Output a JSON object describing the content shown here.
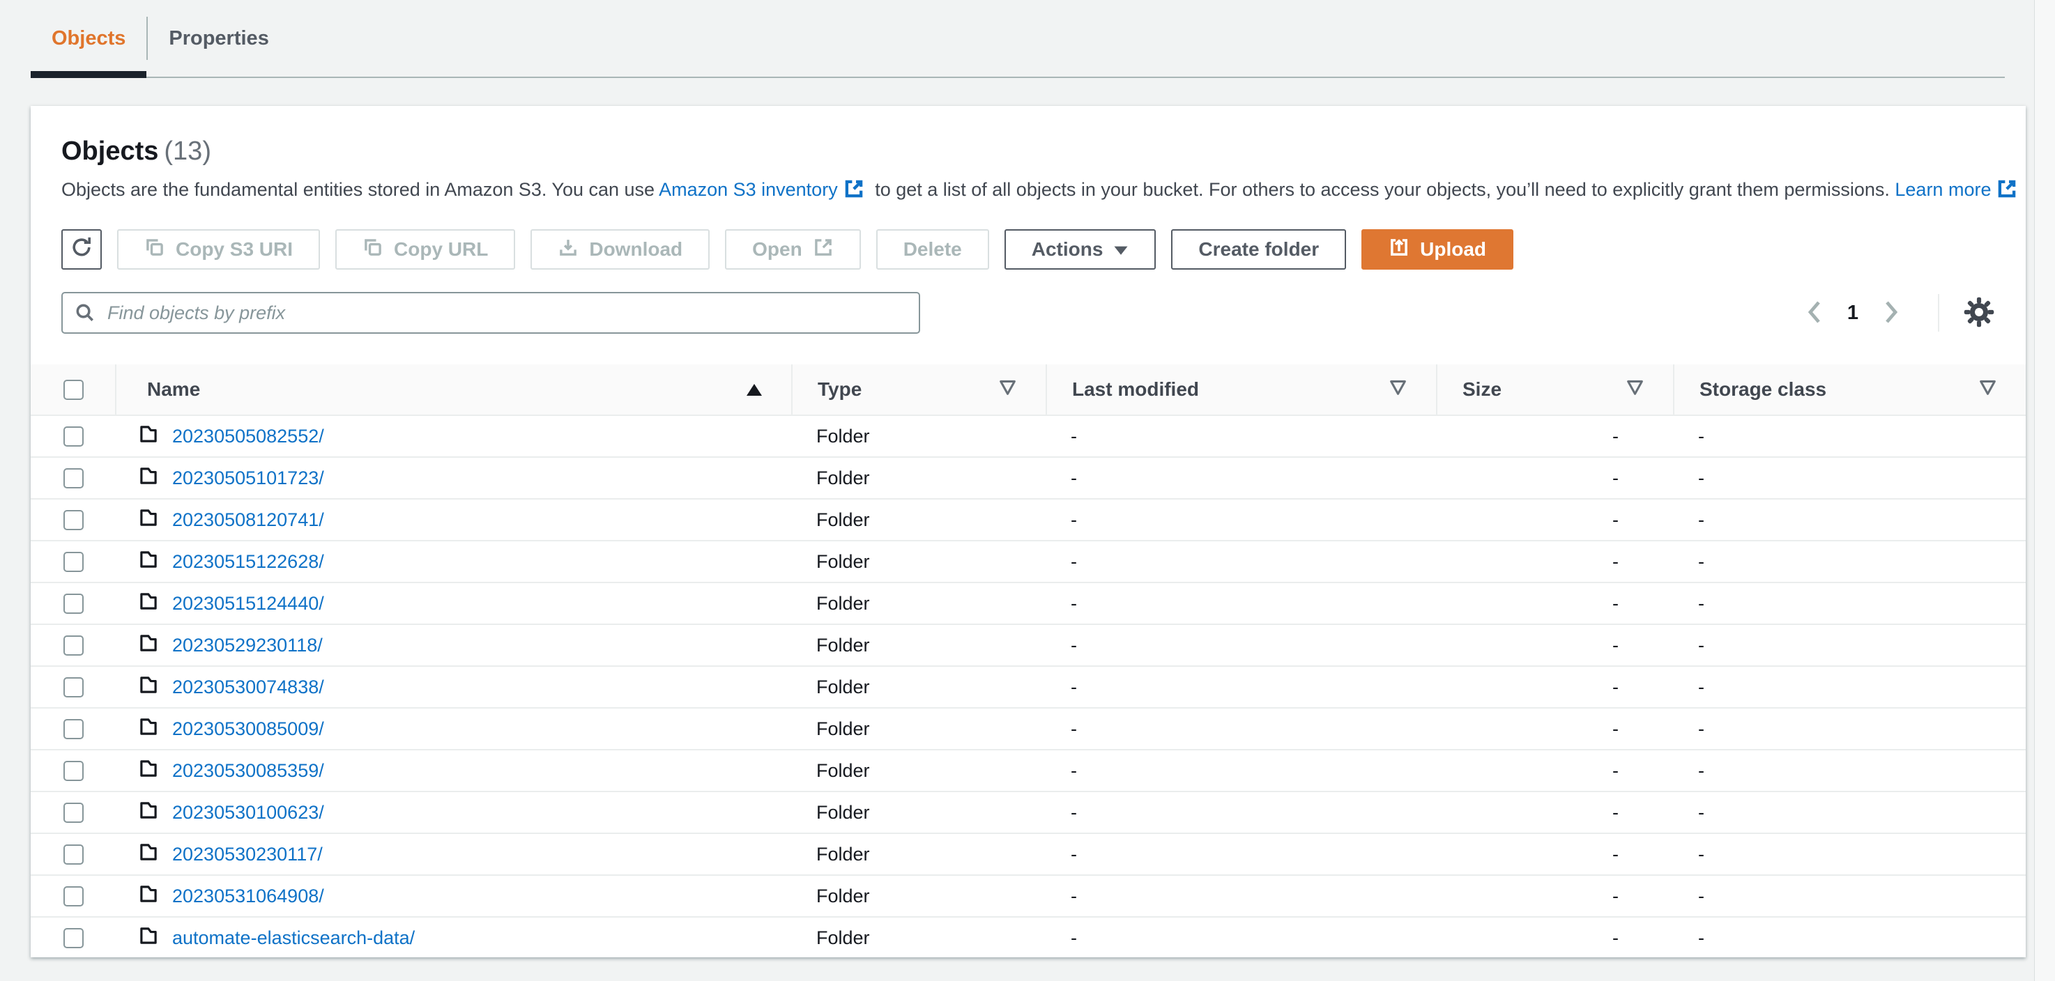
{
  "colors": {
    "accent_orange": "#df7732",
    "tab_active_orange": "#e0752c",
    "link_blue": "#0f72c7",
    "page_background": "#f1f3f3",
    "card_background": "#ffffff",
    "secondary_button": "#545b64",
    "disabled_text": "#aab7b8",
    "row_border": "#eaeded"
  },
  "tabs": [
    {
      "label": "Objects",
      "active": true
    },
    {
      "label": "Properties",
      "active": false
    }
  ],
  "panel": {
    "title": "Objects",
    "count": "(13)",
    "description": {
      "text_1": "Objects are the fundamental entities stored in Amazon S3. You can use ",
      "link_1": "Amazon S3 inventory",
      "text_2": " to get a list of all objects in your bucket. For others to access your objects, you’ll need to explicitly grant them permissions. ",
      "link_2": "Learn more"
    },
    "toolbar": {
      "buttons": [
        {
          "label": "",
          "icon": "refresh-icon",
          "disabled": false
        },
        {
          "label": "Copy S3 URI",
          "icon": "copy-icon",
          "disabled": true
        },
        {
          "label": "Copy URL",
          "icon": "copy-icon",
          "disabled": true
        },
        {
          "label": "Download",
          "icon": "download-icon",
          "disabled": true
        },
        {
          "label": "Open",
          "icon": "external-link-icon",
          "disabled": true
        },
        {
          "label": "Delete",
          "icon": null,
          "disabled": true
        },
        {
          "label": "Actions",
          "icon": "caret-down-icon",
          "disabled": false
        },
        {
          "label": "Create folder",
          "icon": null,
          "disabled": false
        },
        {
          "label": "Upload",
          "icon": "upload-icon",
          "disabled": false,
          "variant": "primary"
        }
      ]
    },
    "search": {
      "placeholder": "Find objects by prefix"
    },
    "pagination": {
      "current_page": "1"
    },
    "table": {
      "columns": [
        {
          "label": "Name",
          "sorted": "ascending"
        },
        {
          "label": "Type",
          "filter": true
        },
        {
          "label": "Last modified",
          "filter": true
        },
        {
          "label": "Size",
          "filter": true
        },
        {
          "label": "Storage class",
          "filter": true
        }
      ],
      "rows": [
        {
          "name": "20230505082552/",
          "type": "Folder",
          "last_modified": "-",
          "size": "-",
          "storage_class": "-"
        },
        {
          "name": "20230505101723/",
          "type": "Folder",
          "last_modified": "-",
          "size": "-",
          "storage_class": "-"
        },
        {
          "name": "20230508120741/",
          "type": "Folder",
          "last_modified": "-",
          "size": "-",
          "storage_class": "-"
        },
        {
          "name": "20230515122628/",
          "type": "Folder",
          "last_modified": "-",
          "size": "-",
          "storage_class": "-"
        },
        {
          "name": "20230515124440/",
          "type": "Folder",
          "last_modified": "-",
          "size": "-",
          "storage_class": "-"
        },
        {
          "name": "20230529230118/",
          "type": "Folder",
          "last_modified": "-",
          "size": "-",
          "storage_class": "-"
        },
        {
          "name": "20230530074838/",
          "type": "Folder",
          "last_modified": "-",
          "size": "-",
          "storage_class": "-"
        },
        {
          "name": "20230530085009/",
          "type": "Folder",
          "last_modified": "-",
          "size": "-",
          "storage_class": "-"
        },
        {
          "name": "20230530085359/",
          "type": "Folder",
          "last_modified": "-",
          "size": "-",
          "storage_class": "-"
        },
        {
          "name": "20230530100623/",
          "type": "Folder",
          "last_modified": "-",
          "size": "-",
          "storage_class": "-"
        },
        {
          "name": "20230530230117/",
          "type": "Folder",
          "last_modified": "-",
          "size": "-",
          "storage_class": "-"
        },
        {
          "name": "20230531064908/",
          "type": "Folder",
          "last_modified": "-",
          "size": "-",
          "storage_class": "-"
        },
        {
          "name": "automate-elasticsearch-data/",
          "type": "Folder",
          "last_modified": "-",
          "size": "-",
          "storage_class": "-"
        }
      ]
    }
  }
}
